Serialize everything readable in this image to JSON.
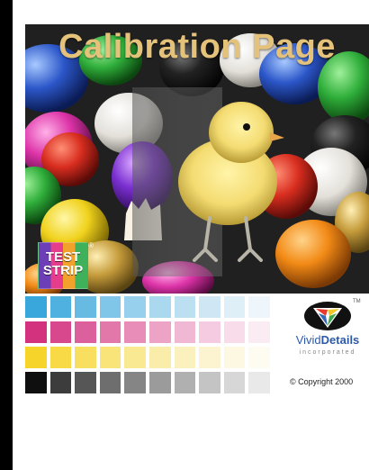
{
  "title": "Calibration Page",
  "logo": {
    "line1": "TEST",
    "line2": "STRIP",
    "mark": "®"
  },
  "brand": {
    "word1": "Vivid",
    "word2": "Details",
    "sub": "incorporated",
    "tm": "TM"
  },
  "copyright": "© Copyright 2000",
  "swatches": {
    "cyan": [
      "#3aa7dc",
      "#4fb1df",
      "#67bbe3",
      "#7fc6e8",
      "#96d0ec",
      "#aad8ef",
      "#bddff2",
      "#cfe7f5",
      "#dfeff8",
      "#eef6fb"
    ],
    "magenta": [
      "#d2327e",
      "#d7498c",
      "#dc609b",
      "#e277aa",
      "#e78db8",
      "#eca3c6",
      "#f0b8d3",
      "#f4cbe0",
      "#f8dcea",
      "#fbecf4"
    ],
    "yellow": [
      "#f6d42a",
      "#f7da45",
      "#f8df60",
      "#f9e47a",
      "#f9e993",
      "#faedaa",
      "#fbf1bf",
      "#fcf4d1",
      "#fdf8e1",
      "#fefbf0"
    ],
    "black": [
      "#0f0f0f",
      "#3c3c3c",
      "#565656",
      "#6e6e6e",
      "#858585",
      "#9b9b9b",
      "#b0b0b0",
      "#c4c4c4",
      "#d7d7d7",
      "#e9e9e9"
    ]
  }
}
